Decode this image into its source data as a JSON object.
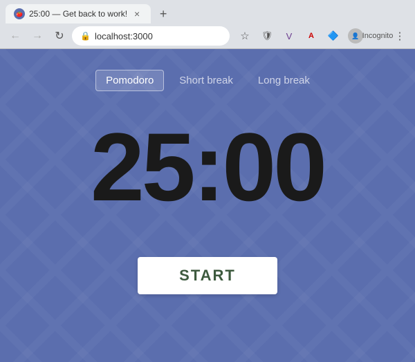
{
  "browser": {
    "tab": {
      "favicon": "🍅",
      "title": "25:00 — Get back to work!",
      "close_label": "×"
    },
    "new_tab_label": "+",
    "nav": {
      "back_label": "←",
      "forward_label": "→",
      "reload_label": "↻",
      "url": "localhost:3000",
      "bookmark_label": "☆",
      "menu_label": "⋮"
    }
  },
  "app": {
    "modes": [
      {
        "id": "pomodoro",
        "label": "Pomodoro",
        "active": true
      },
      {
        "id": "short-break",
        "label": "Short break",
        "active": false
      },
      {
        "id": "long-break",
        "label": "Long break",
        "active": false
      }
    ],
    "timer": {
      "display": "25:00"
    },
    "start_button_label": "START"
  }
}
